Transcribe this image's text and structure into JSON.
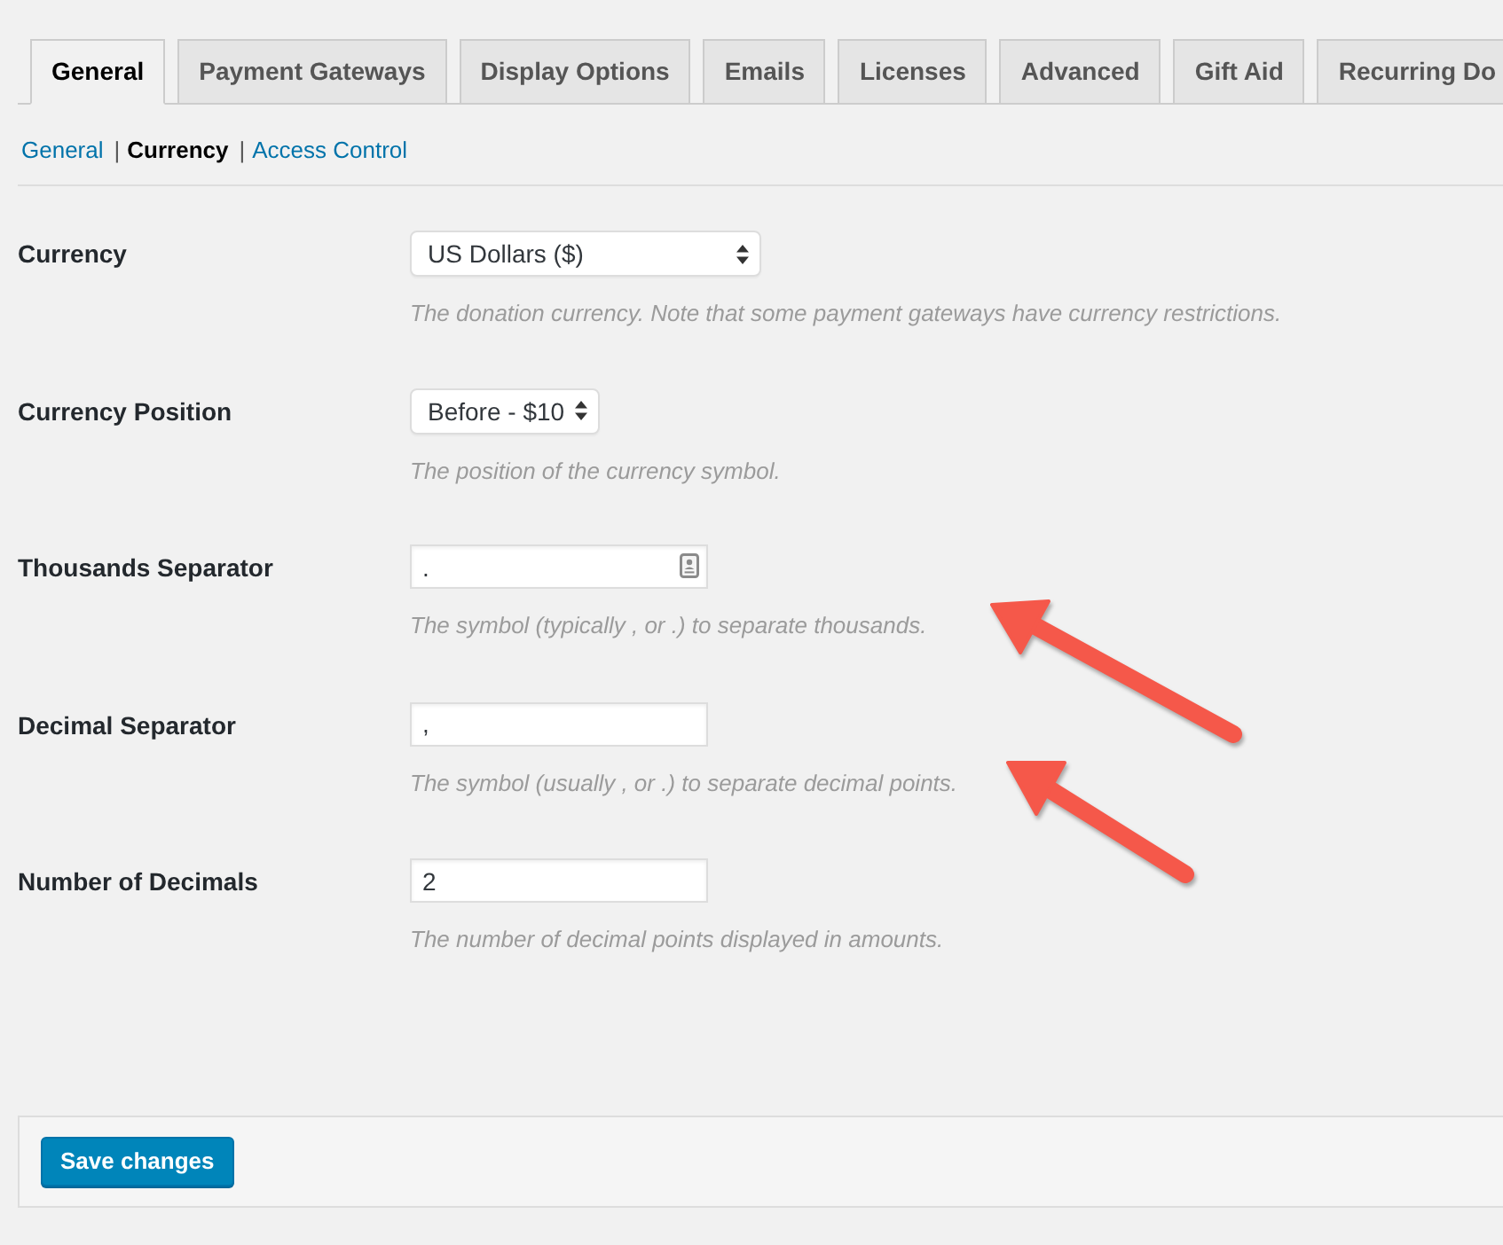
{
  "tabs": [
    {
      "label": "General",
      "selected": true
    },
    {
      "label": "Payment Gateways",
      "selected": false
    },
    {
      "label": "Display Options",
      "selected": false
    },
    {
      "label": "Emails",
      "selected": false
    },
    {
      "label": "Licenses",
      "selected": false
    },
    {
      "label": "Advanced",
      "selected": false
    },
    {
      "label": "Gift Aid",
      "selected": false
    },
    {
      "label": "Recurring Do",
      "selected": false
    }
  ],
  "subnav": [
    {
      "label": "General",
      "selected": false
    },
    {
      "divider": "|",
      "label": "Currency",
      "selected": true
    },
    {
      "divider": "|",
      "label": "Access Control",
      "selected": false
    }
  ],
  "fields": [
    {
      "kind": "select",
      "label": "Currency",
      "value": "US Dollars ($)",
      "description": "The donation currency. Note that some payment gateways have currency restrictions.",
      "autofill_icon": false
    },
    {
      "kind": "select",
      "label": "Currency Position",
      "value": "Before - $10",
      "description": "The position of the currency symbol.",
      "autofill_icon": false
    },
    {
      "kind": "text",
      "label": "Thousands Separator",
      "value": ".",
      "description": "The symbol (typically , or .) to separate thousands.",
      "autofill_icon": true
    },
    {
      "kind": "text",
      "label": "Decimal Separator",
      "value": ",",
      "description": "The symbol (usually , or .) to separate decimal points.",
      "autofill_icon": false
    },
    {
      "kind": "text",
      "label": "Number of Decimals",
      "value": "2",
      "description": "The number of decimal points displayed in amounts.",
      "autofill_icon": false
    }
  ],
  "save_button": {
    "label": "Save changes"
  }
}
